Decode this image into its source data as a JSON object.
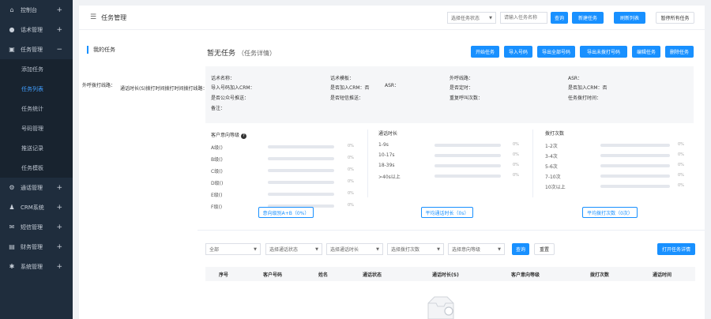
{
  "sidebar": {
    "items": [
      {
        "label": "控制台",
        "icon": "home-icon",
        "expanded": false
      },
      {
        "label": "话术管理",
        "icon": "mic-icon",
        "expanded": false
      },
      {
        "label": "任务管理",
        "icon": "lock-icon",
        "expanded": true
      }
    ],
    "sub_items": [
      "添加任务",
      "任务列表",
      "任务统计",
      "号码管理",
      "推送记录",
      "任务模板"
    ],
    "active_sub": "任务列表",
    "items2": [
      {
        "label": "通话管理",
        "icon": "gear-icon"
      },
      {
        "label": "CRM系统",
        "icon": "user-icon"
      },
      {
        "label": "短信管理",
        "icon": "mail-icon"
      },
      {
        "label": "财务管理",
        "icon": "wallet-icon"
      },
      {
        "label": "系统管理",
        "icon": "settings-icon"
      }
    ]
  },
  "header": {
    "title": "任务管理",
    "status_select": "选择任务状态",
    "search_placeholder": "请输入任务名称",
    "query": "查询",
    "new_task": "新建任务",
    "refresh": "刷新列表",
    "pause_all": "暂停所有任务"
  },
  "left": {
    "title": "我的任务"
  },
  "detail": {
    "title": "暂无任务",
    "subtitle": "（任务详情）",
    "actions": [
      "开始任务",
      "导入号码",
      "导出全部号码",
      "导出未拨打号码",
      "编辑任务",
      "删除任务"
    ],
    "overlay_a": "外呼拨打线路：",
    "overlay_b": "通话时长(S)拨打时间拨打时间拨打线路：",
    "fields": {
      "r1c1": "话术名称：",
      "r1c2": "话术模板：",
      "r1c3": "外呼线路：",
      "r1c4": "ASR：",
      "r2c1": "导入号码加入CRM：",
      "r2c2": "是否加入CRM：否",
      "r2c2b": "ASR：",
      "r2c3": "是否定时：",
      "r2c4": "是否加入CRM：否",
      "r3c1": "是否公众号推送：",
      "r3c2": "是否短信推送：",
      "r3c3": "重复呼叫次数：",
      "r3c4": "任务拨打时间：",
      "r4c1": "备注："
    }
  },
  "stats": {
    "intent": {
      "title": "客户意向等级",
      "help_icon": "?",
      "rows": [
        "A级()",
        "B级()",
        "C级()",
        "D级()",
        "E级()",
        "F级()"
      ],
      "pct": "0%",
      "button": "意向级别A+B（0%）"
    },
    "duration": {
      "title": "通话时长",
      "rows": [
        "1-9s",
        "10-17s",
        "18-39s",
        ">40s以上"
      ],
      "pct": "0%",
      "button": "平均通话时长（0s）"
    },
    "times": {
      "title": "拨打次数",
      "rows": [
        "1-2次",
        "3-4次",
        "5-6次",
        "7-10次",
        "10次以上"
      ],
      "pct": "0%",
      "button": "平均拨打次数（0次）"
    }
  },
  "filters": {
    "all": "全部",
    "call_status": "选择通话状态",
    "call_duration": "选择通话时长",
    "call_times": "选择拨打次数",
    "intent": "选择意向等级",
    "query": "查询",
    "reset": "重置",
    "open_detail": "打开任务详情"
  },
  "table": {
    "columns": [
      "序号",
      "客户号码",
      "姓名",
      "通话状态",
      "通话时长(S)",
      "客户意向等级",
      "拨打次数",
      "通话时间"
    ]
  }
}
